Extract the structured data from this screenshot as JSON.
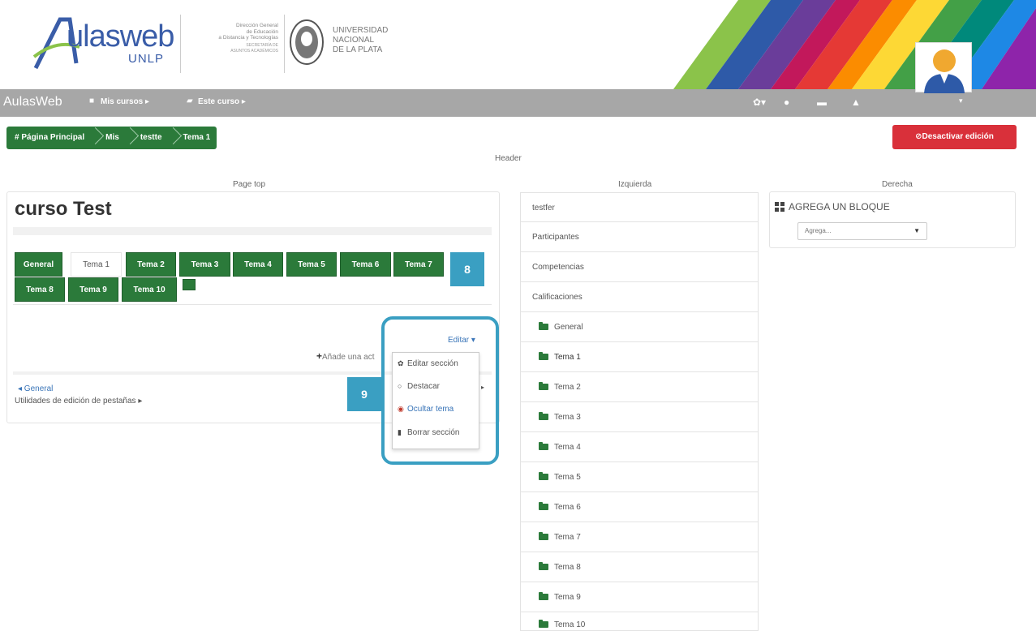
{
  "header": {
    "logo_main": "ulasweb",
    "logo_sub": "UNLP",
    "direccion_lines": [
      "Dirección General",
      "de Educación",
      "a Distancia y Tecnologías"
    ],
    "direccion_sub": [
      "SECRETARÍA DE",
      "ASUNTOS ACADÉMICOS"
    ],
    "univ_lines": [
      "UNIVERSIDAD",
      "NACIONAL",
      "DE LA PLATA"
    ]
  },
  "navbar": {
    "brand": "AulasWeb",
    "mis_cursos": "Mis cursos ▸",
    "este_curso": "Este curso ▸",
    "user_caret": "▾"
  },
  "breadcrumb": [
    {
      "label": "# Página Principal"
    },
    {
      "label": "Mis"
    },
    {
      "label": "testte"
    },
    {
      "label": "Tema 1"
    }
  ],
  "buttons": {
    "desactivar": "⊘Desactivar edición"
  },
  "regions": {
    "header": "Header",
    "page_top": "Page top",
    "izquierda": "Izquierda",
    "derecha": "Derecha"
  },
  "course": {
    "title": "curso Test"
  },
  "tabs_row1": [
    "General",
    "Tema 1",
    "Tema 2",
    "Tema 3",
    "Tema 4",
    "Tema 5",
    "Tema 6",
    "Tema 7"
  ],
  "tabs_row2": [
    "Tema 8",
    "Tema 9",
    "Tema 10"
  ],
  "badges": {
    "b8": "8",
    "b9": "9"
  },
  "section": {
    "editar": "Editar ▾",
    "anade": "Añade una act",
    "prev_general": "◂ General",
    "utilidades": "Utilidades de edición de pestañas ▸"
  },
  "dropdown": [
    {
      "icon": "gear-icon",
      "glyph": "✿",
      "label": "Editar sección"
    },
    {
      "icon": "circle-icon",
      "glyph": "○",
      "label": "Destacar"
    },
    {
      "icon": "eye-icon",
      "glyph": "◉",
      "label": "Ocultar tema"
    },
    {
      "icon": "trash-icon",
      "glyph": "▮",
      "label": "Borrar sección"
    }
  ],
  "left_list": [
    {
      "label": "testfer",
      "folder": false
    },
    {
      "label": "Participantes",
      "folder": false
    },
    {
      "label": "Competencias",
      "folder": false
    },
    {
      "label": "Calificaciones",
      "folder": false
    },
    {
      "label": "General",
      "folder": true
    },
    {
      "label": "Tema 1",
      "folder": true
    },
    {
      "label": "Tema 2",
      "folder": true
    },
    {
      "label": "Tema 3",
      "folder": true
    },
    {
      "label": "Tema 4",
      "folder": true
    },
    {
      "label": "Tema 5",
      "folder": true
    },
    {
      "label": "Tema 6",
      "folder": true
    },
    {
      "label": "Tema 7",
      "folder": true
    },
    {
      "label": "Tema 8",
      "folder": true
    },
    {
      "label": "Tema 9",
      "folder": true
    },
    {
      "label": "Tema 10",
      "folder": true
    }
  ],
  "derecha": {
    "bloque_title": "AGREGA UN BLOQUE",
    "select_value": "Agrega..."
  },
  "colors": {
    "green": "#2b7a3a",
    "red": "#d9303a",
    "badge": "#3a9fc2",
    "navbar": "#a7a7a7"
  }
}
